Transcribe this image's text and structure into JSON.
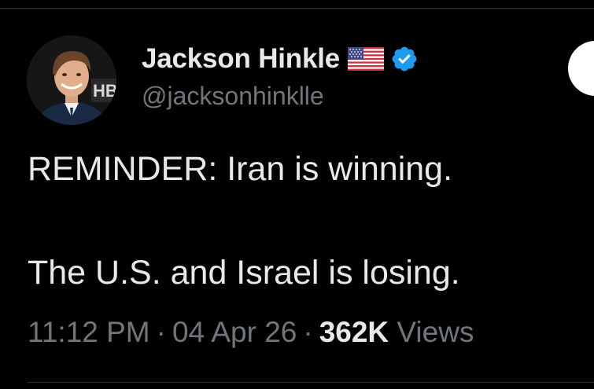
{
  "tweet": {
    "author": {
      "display_name": "Jackson Hinkle",
      "handle": "@jacksonhinklle",
      "flag_icon": "us-flag-icon",
      "verified_icon": "verified-badge-icon",
      "verified_color": "#1d9bf0",
      "avatar": "profile-photo",
      "avatar_backdrop_text": "HB"
    },
    "text_lines": [
      "REMINDER: Iran is winning.",
      "The U.S. and Israel is losing."
    ],
    "meta": {
      "time": "11:12 PM",
      "separator": "·",
      "date": "04 Apr 26",
      "views_count": "362K",
      "views_label": "Views"
    }
  },
  "colors": {
    "background": "#000000",
    "primary_text": "#e7e9ea",
    "secondary_text": "#71767b",
    "divider": "#2f3336"
  }
}
